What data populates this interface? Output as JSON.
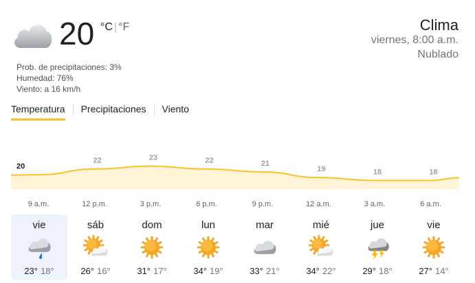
{
  "header": {
    "temperature": "20",
    "unit_c": "°C",
    "unit_sep": "|",
    "unit_f": "°F",
    "precipitation": "Prob. de precipitaciones: 3%",
    "humidity": "Humedad: 76%",
    "wind": "Viento: a 16 km/h",
    "title": "Clima",
    "datetime": "viernes, 8:00 a.m.",
    "condition": "Nublado",
    "current_icon": "cloudy-icon"
  },
  "tabs": [
    {
      "label": "Temperatura",
      "active": true
    },
    {
      "label": "Precipitaciones",
      "active": false
    },
    {
      "label": "Viento",
      "active": false
    }
  ],
  "chart_data": {
    "type": "area",
    "x": [
      "9 a.m.",
      "12 p.m.",
      "3 p.m.",
      "6 p.m.",
      "9 p.m.",
      "12 a.m.",
      "3 a.m.",
      "6 a.m."
    ],
    "values": [
      20,
      22,
      23,
      22,
      21,
      19,
      18,
      18
    ],
    "line_color": "#fbc02d",
    "fill_color": "#fff5d6"
  },
  "days": [
    {
      "name": "vie",
      "icon": "rain-cloud-icon",
      "high": "23°",
      "low": "18°",
      "selected": true
    },
    {
      "name": "sáb",
      "icon": "partly-sunny-icon",
      "high": "26°",
      "low": "16°",
      "selected": false
    },
    {
      "name": "dom",
      "icon": "sun-icon",
      "high": "31°",
      "low": "17°",
      "selected": false
    },
    {
      "name": "lun",
      "icon": "sun-icon",
      "high": "34°",
      "low": "19°",
      "selected": false
    },
    {
      "name": "mar",
      "icon": "cloudy-icon",
      "high": "33°",
      "low": "21°",
      "selected": false
    },
    {
      "name": "mié",
      "icon": "partly-sunny-icon",
      "high": "34°",
      "low": "22°",
      "selected": false
    },
    {
      "name": "jue",
      "icon": "thunderstorm-icon",
      "high": "29°",
      "low": "18°",
      "selected": false
    },
    {
      "name": "vie",
      "icon": "sun-icon",
      "high": "27°",
      "low": "14°",
      "selected": false
    }
  ]
}
